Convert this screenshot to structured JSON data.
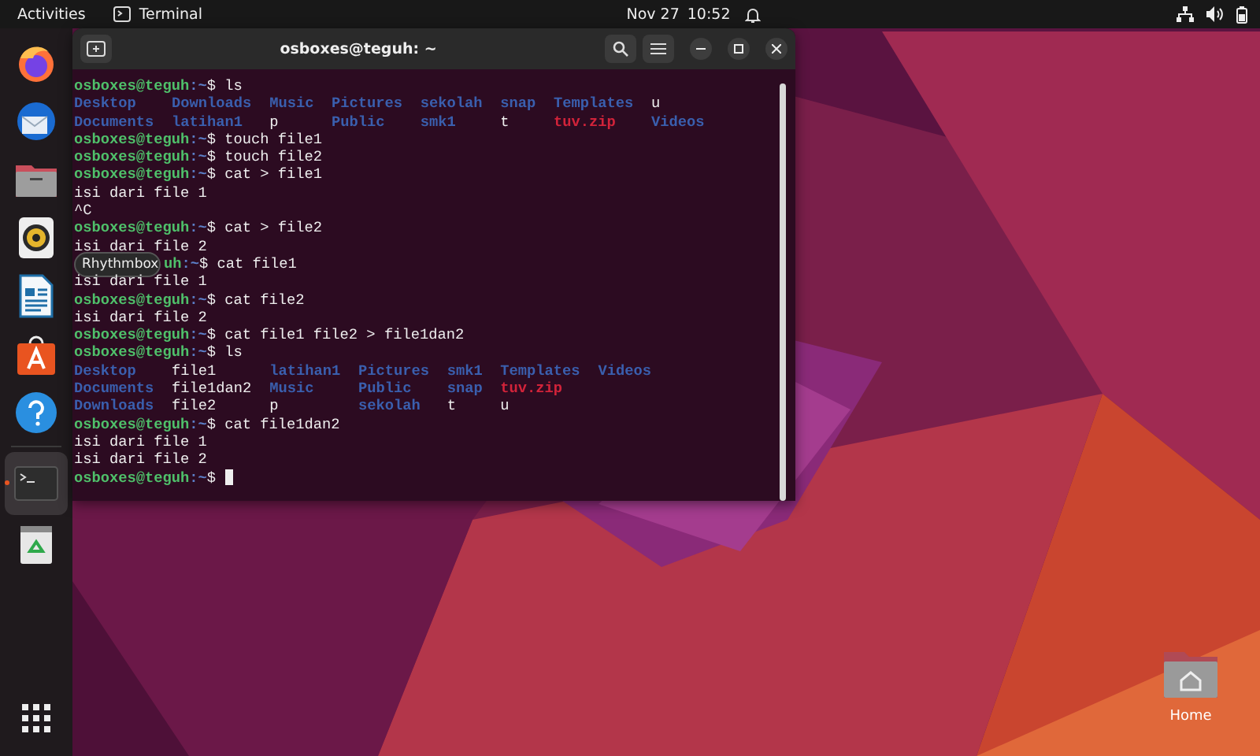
{
  "top_bar": {
    "activities": "Activities",
    "app_name": "Terminal",
    "date": "Nov 27",
    "time": "10:52"
  },
  "dock": {
    "items": [
      {
        "kind": "firefox",
        "selected": false
      },
      {
        "kind": "mail",
        "selected": false
      },
      {
        "kind": "files",
        "selected": false
      },
      {
        "kind": "speaker",
        "selected": false
      },
      {
        "kind": "writer",
        "selected": false
      },
      {
        "kind": "store",
        "selected": false
      },
      {
        "kind": "help",
        "selected": false
      },
      {
        "kind": "terminal",
        "selected": true
      },
      {
        "kind": "trash",
        "selected": false
      }
    ],
    "tooltip": "Rhythmbox"
  },
  "terminal": {
    "title": "osboxes@teguh: ~",
    "lines": [
      {
        "kind": "prompt",
        "user": "osboxes@teguh",
        "path": ":~",
        "symbol": "$",
        "command": "ls"
      },
      {
        "kind": "ls",
        "entries": [
          {
            "name": "Desktop",
            "color": "#3a5fae"
          },
          {
            "name": "Downloads",
            "color": "#3a5fae"
          },
          {
            "name": "Music",
            "color": "#3a5fae"
          },
          {
            "name": "Pictures",
            "color": "#3a5fae"
          },
          {
            "name": "sekolah",
            "color": "#3a5fae"
          },
          {
            "name": "snap",
            "color": "#3a5fae"
          },
          {
            "name": "Templates",
            "color": "#3a5fae"
          },
          {
            "name": "u",
            "color": "#eeeeee"
          }
        ]
      },
      {
        "kind": "ls",
        "entries": [
          {
            "name": "Documents",
            "color": "#3a5fae"
          },
          {
            "name": "latihan1",
            "color": "#3a5fae"
          },
          {
            "name": "p",
            "color": "#eeeeee"
          },
          {
            "name": "Public",
            "color": "#3a5fae"
          },
          {
            "name": "smk1",
            "color": "#3a5fae"
          },
          {
            "name": "t",
            "color": "#eeeeee"
          },
          {
            "name": "tuv.zip",
            "color": "#d2233a"
          },
          {
            "name": "Videos",
            "color": "#3a5fae"
          }
        ]
      },
      {
        "kind": "prompt",
        "user": "osboxes@teguh",
        "path": ":~",
        "symbol": "$",
        "command": "touch file1"
      },
      {
        "kind": "prompt",
        "user": "osboxes@teguh",
        "path": ":~",
        "symbol": "$",
        "command": "touch file2"
      },
      {
        "kind": "prompt",
        "user": "osboxes@teguh",
        "path": ":~",
        "symbol": "$",
        "command": "cat > file1"
      },
      {
        "kind": "output",
        "text": "isi dari file 1"
      },
      {
        "kind": "output",
        "text": "^C"
      },
      {
        "kind": "prompt",
        "user": "osboxes@teguh",
        "path": ":~",
        "symbol": "$",
        "command": "cat > file2"
      },
      {
        "kind": "output",
        "text": "isi dari file 2"
      },
      {
        "kind": "covered_prompt",
        "user": "uh",
        "path": ":~",
        "symbol": "$",
        "command": "cat file1"
      },
      {
        "kind": "output",
        "text": "isi dari file 1"
      },
      {
        "kind": "prompt",
        "user": "osboxes@teguh",
        "path": ":~",
        "symbol": "$",
        "command": "cat file2"
      },
      {
        "kind": "output",
        "text": "isi dari file 2"
      },
      {
        "kind": "prompt",
        "user": "osboxes@teguh",
        "path": ":~",
        "symbol": "$",
        "command": "cat file1 file2 > file1dan2"
      },
      {
        "kind": "prompt",
        "user": "osboxes@teguh",
        "path": ":~",
        "symbol": "$",
        "command": "ls"
      },
      {
        "kind": "ls",
        "entries": [
          {
            "name": "Desktop",
            "color": "#3a5fae"
          },
          {
            "name": "file1",
            "color": "#eeeeee"
          },
          {
            "name": "latihan1",
            "color": "#3a5fae"
          },
          {
            "name": "Pictures",
            "color": "#3a5fae"
          },
          {
            "name": "smk1",
            "color": "#3a5fae"
          },
          {
            "name": "Templates",
            "color": "#3a5fae"
          },
          {
            "name": "Videos",
            "color": "#3a5fae"
          }
        ]
      },
      {
        "kind": "ls",
        "entries": [
          {
            "name": "Documents",
            "color": "#3a5fae"
          },
          {
            "name": "file1dan2",
            "color": "#eeeeee"
          },
          {
            "name": "Music",
            "color": "#3a5fae"
          },
          {
            "name": "Public",
            "color": "#3a5fae"
          },
          {
            "name": "snap",
            "color": "#3a5fae"
          },
          {
            "name": "tuv.zip",
            "color": "#d2233a"
          }
        ]
      },
      {
        "kind": "ls",
        "entries": [
          {
            "name": "Downloads",
            "color": "#3a5fae"
          },
          {
            "name": "file2",
            "color": "#eeeeee"
          },
          {
            "name": "p",
            "color": "#eeeeee"
          },
          {
            "name": "sekolah",
            "color": "#3a5fae"
          },
          {
            "name": "t",
            "color": "#eeeeee"
          },
          {
            "name": "u",
            "color": "#eeeeee"
          }
        ]
      },
      {
        "kind": "prompt",
        "user": "osboxes@teguh",
        "path": ":~",
        "symbol": "$",
        "command": "cat file1dan2"
      },
      {
        "kind": "output",
        "text": "isi dari file 1"
      },
      {
        "kind": "output",
        "text": "isi dari file 2"
      },
      {
        "kind": "active_prompt",
        "user": "osboxes@teguh",
        "path": ":~",
        "symbol": "$"
      }
    ]
  },
  "desktop": {
    "icons": [
      {
        "label": "Home"
      }
    ]
  }
}
